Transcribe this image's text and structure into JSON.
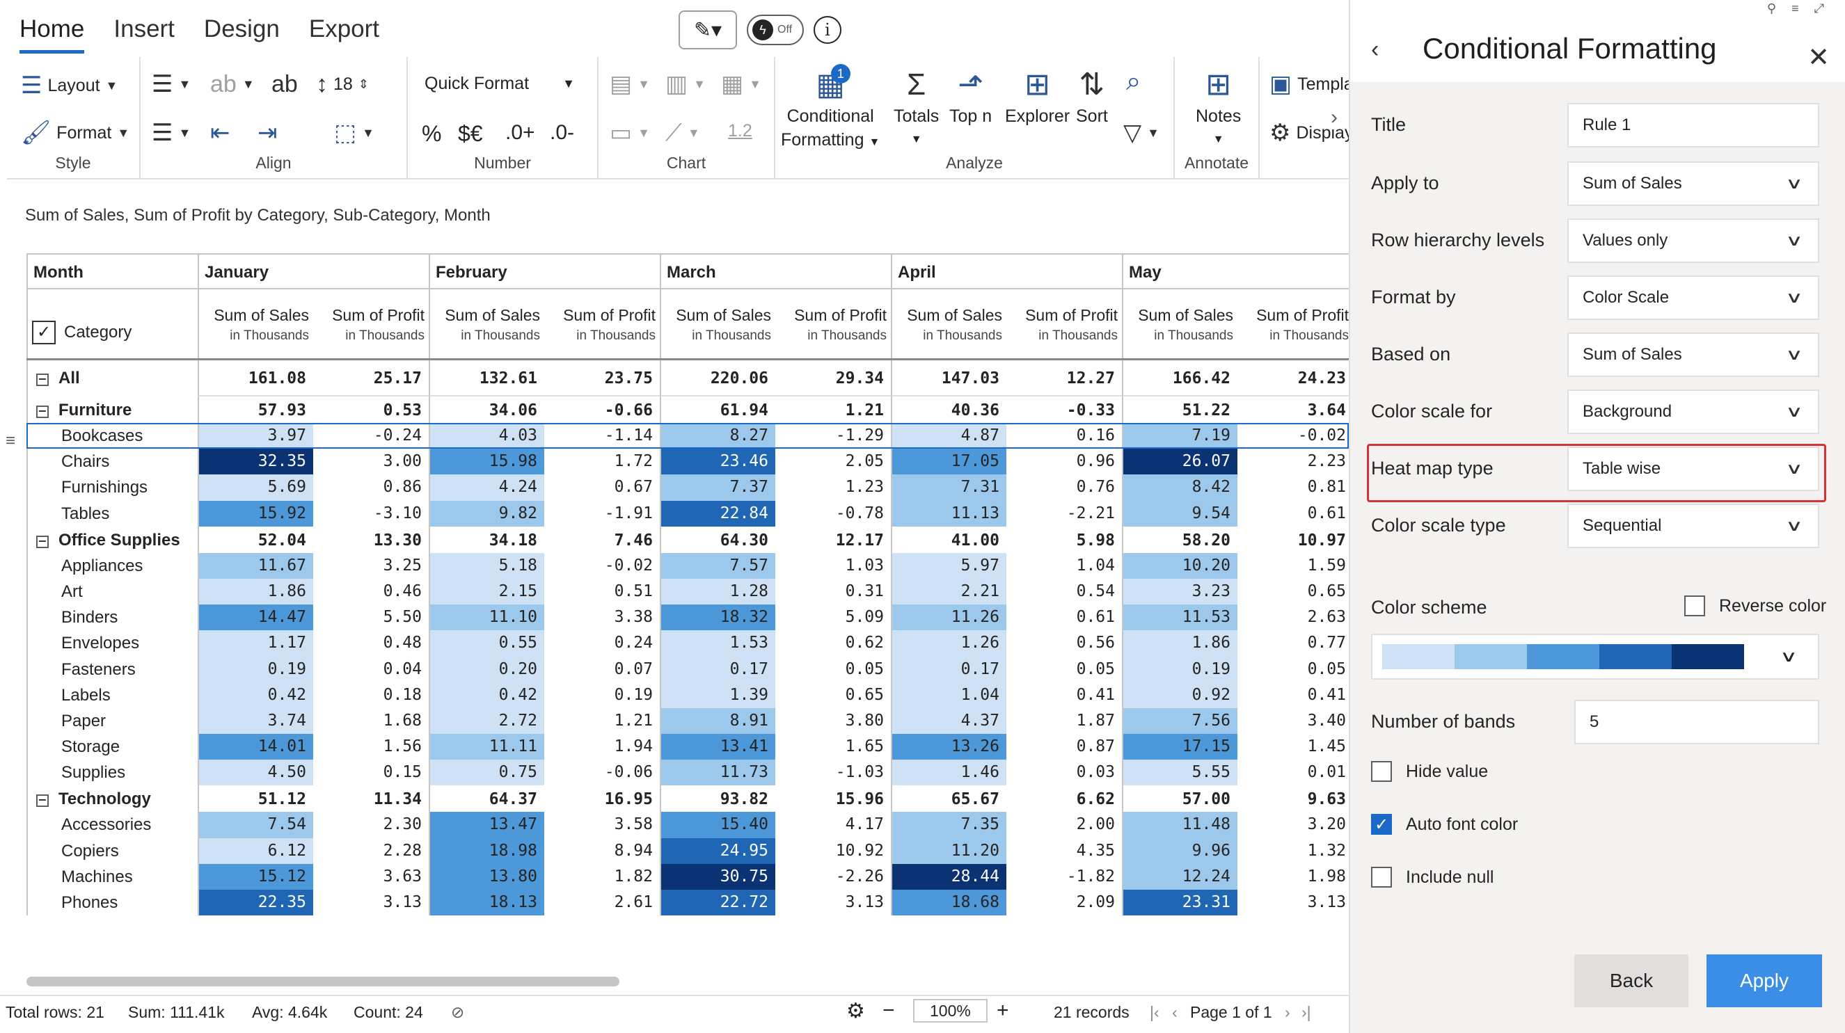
{
  "tabs": [
    "Home",
    "Insert",
    "Design",
    "Export"
  ],
  "toggle_label": "Off",
  "ribbon": {
    "style": {
      "label": "Style",
      "layout": "Layout",
      "format": "Format"
    },
    "align": {
      "label": "Align",
      "font_size": "18"
    },
    "number": {
      "label": "Number",
      "quick_format": "Quick Format",
      "percent": "%",
      "currency": "$€",
      "dec_inc": ".0+",
      "dec_dec": ".0-"
    },
    "chart": {
      "label": "Chart",
      "decimal": "1.2"
    },
    "analyze": {
      "label": "Analyze",
      "conditional_l1": "Conditional",
      "conditional_l2": "Formatting",
      "badge": "1",
      "totals": "Totals",
      "topn": "Top n",
      "explorer": "Explorer",
      "sort": "Sort"
    },
    "annotate": {
      "label": "Annotate",
      "notes": "Notes"
    },
    "extra": {
      "template": "Templa",
      "display": "Display"
    }
  },
  "subtitle": "Sum of Sales, Sum of Profit by Category, Sub-Category, Month",
  "table": {
    "corner_label": "Month",
    "category_label": "Category",
    "months": [
      "January",
      "February",
      "March",
      "April",
      "May"
    ],
    "measure_sales": "Sum of Sales",
    "measure_profit": "Sum of Profit",
    "measure_sub": "in Thousands",
    "rows": [
      {
        "label": "All",
        "type": "total",
        "values": [
          "161.08",
          "25.17",
          "132.61",
          "23.75",
          "220.06",
          "29.34",
          "147.03",
          "12.27",
          "166.42",
          "24.23"
        ]
      },
      {
        "label": "Furniture",
        "type": "group",
        "values": [
          "57.93",
          "0.53",
          "34.06",
          "-0.66",
          "61.94",
          "1.21",
          "40.36",
          "-0.33",
          "51.22",
          "3.64"
        ]
      },
      {
        "label": "Bookcases",
        "type": "child",
        "selected": true,
        "values": [
          "3.97",
          "-0.24",
          "4.03",
          "-1.14",
          "8.27",
          "-1.29",
          "4.87",
          "0.16",
          "7.19",
          "-0.02"
        ]
      },
      {
        "label": "Chairs",
        "type": "child",
        "values": [
          "32.35",
          "3.00",
          "15.98",
          "1.72",
          "23.46",
          "2.05",
          "17.05",
          "0.96",
          "26.07",
          "2.23"
        ]
      },
      {
        "label": "Furnishings",
        "type": "child",
        "values": [
          "5.69",
          "0.86",
          "4.24",
          "0.67",
          "7.37",
          "1.23",
          "7.31",
          "0.76",
          "8.42",
          "0.81"
        ]
      },
      {
        "label": "Tables",
        "type": "child",
        "values": [
          "15.92",
          "-3.10",
          "9.82",
          "-1.91",
          "22.84",
          "-0.78",
          "11.13",
          "-2.21",
          "9.54",
          "0.61"
        ]
      },
      {
        "label": "Office Supplies",
        "type": "group",
        "values": [
          "52.04",
          "13.30",
          "34.18",
          "7.46",
          "64.30",
          "12.17",
          "41.00",
          "5.98",
          "58.20",
          "10.97"
        ]
      },
      {
        "label": "Appliances",
        "type": "child",
        "values": [
          "11.67",
          "3.25",
          "5.18",
          "-0.02",
          "7.57",
          "1.03",
          "5.97",
          "1.04",
          "10.20",
          "1.59"
        ]
      },
      {
        "label": "Art",
        "type": "child",
        "values": [
          "1.86",
          "0.46",
          "2.15",
          "0.51",
          "1.28",
          "0.31",
          "2.21",
          "0.54",
          "3.23",
          "0.65"
        ]
      },
      {
        "label": "Binders",
        "type": "child",
        "values": [
          "14.47",
          "5.50",
          "11.10",
          "3.38",
          "18.32",
          "5.09",
          "11.26",
          "0.61",
          "11.53",
          "2.63"
        ]
      },
      {
        "label": "Envelopes",
        "type": "child",
        "values": [
          "1.17",
          "0.48",
          "0.55",
          "0.24",
          "1.53",
          "0.62",
          "1.26",
          "0.56",
          "1.86",
          "0.77"
        ]
      },
      {
        "label": "Fasteners",
        "type": "child",
        "values": [
          "0.19",
          "0.04",
          "0.20",
          "0.07",
          "0.17",
          "0.05",
          "0.17",
          "0.05",
          "0.19",
          "0.05"
        ]
      },
      {
        "label": "Labels",
        "type": "child",
        "values": [
          "0.42",
          "0.18",
          "0.42",
          "0.19",
          "1.39",
          "0.65",
          "1.04",
          "0.41",
          "0.92",
          "0.41"
        ]
      },
      {
        "label": "Paper",
        "type": "child",
        "values": [
          "3.74",
          "1.68",
          "2.72",
          "1.21",
          "8.91",
          "3.80",
          "4.37",
          "1.87",
          "7.56",
          "3.40"
        ]
      },
      {
        "label": "Storage",
        "type": "child",
        "values": [
          "14.01",
          "1.56",
          "11.11",
          "1.94",
          "13.41",
          "1.65",
          "13.26",
          "0.87",
          "17.15",
          "1.45"
        ]
      },
      {
        "label": "Supplies",
        "type": "child",
        "values": [
          "4.50",
          "0.15",
          "0.75",
          "-0.06",
          "11.73",
          "-1.03",
          "1.46",
          "0.03",
          "5.55",
          "0.01"
        ]
      },
      {
        "label": "Technology",
        "type": "group",
        "values": [
          "51.12",
          "11.34",
          "64.37",
          "16.95",
          "93.82",
          "15.96",
          "65.67",
          "6.62",
          "57.00",
          "9.63"
        ]
      },
      {
        "label": "Accessories",
        "type": "child",
        "values": [
          "7.54",
          "2.30",
          "13.47",
          "3.58",
          "15.40",
          "4.17",
          "7.35",
          "2.00",
          "11.48",
          "3.20"
        ]
      },
      {
        "label": "Copiers",
        "type": "child",
        "values": [
          "6.12",
          "2.28",
          "18.98",
          "8.94",
          "24.95",
          "10.92",
          "11.20",
          "4.35",
          "9.96",
          "1.32"
        ]
      },
      {
        "label": "Machines",
        "type": "child",
        "values": [
          "15.12",
          "3.63",
          "13.80",
          "1.82",
          "30.75",
          "-2.26",
          "28.44",
          "-1.82",
          "12.24",
          "1.98"
        ]
      },
      {
        "label": "Phones",
        "type": "child",
        "values": [
          "22.35",
          "3.13",
          "18.13",
          "2.61",
          "22.72",
          "3.13",
          "18.68",
          "2.09",
          "23.31",
          "3.13"
        ]
      }
    ]
  },
  "heat_colors": [
    "#cfe1f5",
    "#9cc8ec",
    "#4c98d9",
    "#1f66b5",
    "#0b3272"
  ],
  "status": {
    "total_rows": "Total rows: 21",
    "sum": "Sum: 111.41k",
    "avg": "Avg: 4.64k",
    "count": "Count: 24",
    "zoom": "100%",
    "records": "21 records",
    "page": "Page 1 of 1"
  },
  "panel": {
    "title": "Conditional Formatting",
    "fields": [
      {
        "label": "Title",
        "value": "Rule 1",
        "dropdown": false
      },
      {
        "label": "Apply to",
        "value": "Sum of Sales",
        "dropdown": true
      },
      {
        "label": "Row hierarchy levels",
        "value": "Values only",
        "dropdown": true
      },
      {
        "label": "Format by",
        "value": "Color Scale",
        "dropdown": true
      },
      {
        "label": "Based on",
        "value": "Sum of Sales",
        "dropdown": true
      },
      {
        "label": "Color scale for",
        "value": "Background",
        "dropdown": true
      },
      {
        "label": "Heat map type",
        "value": "Table wise",
        "dropdown": true
      },
      {
        "label": "Color scale type",
        "value": "Sequential",
        "dropdown": true
      }
    ],
    "color_scheme_label": "Color scheme",
    "reverse_color_label": "Reverse color",
    "bands_label": "Number of bands",
    "bands_value": "5",
    "hide_value_label": "Hide value",
    "auto_font_label": "Auto font color",
    "include_null_label": "Include null",
    "back_label": "Back",
    "apply_label": "Apply"
  }
}
